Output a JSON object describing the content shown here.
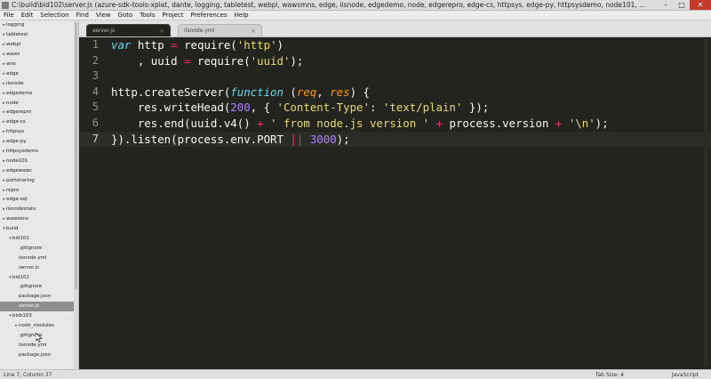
{
  "window": {
    "title": "C:\\build\\bid102\\server.js (azure-sdk-tools-xplat, dante, logging, tabletest, webpi, wawsmns, edge, iisnode, edgedemo, node, edgerepro, edge-cs, httpsys, edge-py, httpsysdemo, node101, ...",
    "buttons": {
      "minimize": "–",
      "maximize": "□",
      "close": "✕"
    }
  },
  "menu": [
    "File",
    "Edit",
    "Selection",
    "Find",
    "View",
    "Goto",
    "Tools",
    "Project",
    "Preferences",
    "Help"
  ],
  "sidebar": {
    "items": [
      {
        "label": "logging",
        "indent": 0,
        "arrow": "▸"
      },
      {
        "label": "tabletest",
        "indent": 0,
        "arrow": "▸"
      },
      {
        "label": "webpi",
        "indent": 0,
        "arrow": "▸"
      },
      {
        "label": "waws",
        "indent": 0,
        "arrow": "▸"
      },
      {
        "label": "wns",
        "indent": 0,
        "arrow": "▸"
      },
      {
        "label": "edge",
        "indent": 0,
        "arrow": "▸"
      },
      {
        "label": "iisnode",
        "indent": 0,
        "arrow": "▸"
      },
      {
        "label": "edgedemo",
        "indent": 0,
        "arrow": "▸"
      },
      {
        "label": "node",
        "indent": 0,
        "arrow": "▸"
      },
      {
        "label": "edgerepro",
        "indent": 0,
        "arrow": "▸"
      },
      {
        "label": "edge-cs",
        "indent": 0,
        "arrow": "▸"
      },
      {
        "label": "httpsys",
        "indent": 0,
        "arrow": "▸"
      },
      {
        "label": "edge-py",
        "indent": 0,
        "arrow": "▸"
      },
      {
        "label": "httpsysdemo",
        "indent": 0,
        "arrow": "▸"
      },
      {
        "label": "node101",
        "indent": 0,
        "arrow": "▸"
      },
      {
        "label": "edgewawc",
        "indent": 0,
        "arrow": "▸"
      },
      {
        "label": "portsharing",
        "indent": 0,
        "arrow": "▸"
      },
      {
        "label": "repro",
        "indent": 0,
        "arrow": "▸"
      },
      {
        "label": "edge-sql",
        "indent": 0,
        "arrow": "▸"
      },
      {
        "label": "iisnodestats",
        "indent": 0,
        "arrow": "▸"
      },
      {
        "label": "wawsenv",
        "indent": 0,
        "arrow": "▸"
      },
      {
        "label": "build",
        "indent": 0,
        "arrow": "▾"
      },
      {
        "label": "bid101",
        "indent": 1,
        "arrow": "▾"
      },
      {
        "label": ".gitignore",
        "indent": 2,
        "arrow": ""
      },
      {
        "label": "iisnode.yml",
        "indent": 2,
        "arrow": ""
      },
      {
        "label": "server.js",
        "indent": 2,
        "arrow": ""
      },
      {
        "label": "bid102",
        "indent": 1,
        "arrow": "▾"
      },
      {
        "label": ".gitignore",
        "indent": 2,
        "arrow": ""
      },
      {
        "label": "package.json",
        "indent": 2,
        "arrow": ""
      },
      {
        "label": "server.js",
        "indent": 2,
        "arrow": "",
        "selected": true
      },
      {
        "label": "bisb103",
        "indent": 1,
        "arrow": "▾"
      },
      {
        "label": "node_modules",
        "indent": 2,
        "arrow": "▸"
      },
      {
        "label": ".gitignore",
        "indent": 2,
        "arrow": ""
      },
      {
        "label": "iisnode.yml",
        "indent": 2,
        "arrow": ""
      },
      {
        "label": "package.json",
        "indent": 2,
        "arrow": ""
      }
    ]
  },
  "tabs": [
    {
      "label": "server.js",
      "close": "×",
      "active": true
    },
    {
      "label": "iisnode.yml",
      "close": "×",
      "active": false
    }
  ],
  "editor": {
    "line_numbers": [
      "1",
      "2",
      "3",
      "4",
      "5",
      "6",
      "7"
    ],
    "current_line": "7",
    "lines": [
      [
        {
          "t": "var",
          "c": "k"
        },
        {
          "t": " http ",
          "c": ""
        },
        {
          "t": "=",
          "c": "o"
        },
        {
          "t": " require(",
          "c": ""
        },
        {
          "t": "'http'",
          "c": "s"
        },
        {
          "t": ")",
          "c": ""
        }
      ],
      [
        {
          "t": "    , uuid ",
          "c": ""
        },
        {
          "t": "=",
          "c": "o"
        },
        {
          "t": " require(",
          "c": ""
        },
        {
          "t": "'uuid'",
          "c": "s"
        },
        {
          "t": ");",
          "c": ""
        }
      ],
      [],
      [
        {
          "t": "http.createServer(",
          "c": ""
        },
        {
          "t": "function",
          "c": "k"
        },
        {
          "t": " (",
          "c": ""
        },
        {
          "t": "req",
          "c": "p"
        },
        {
          "t": ", ",
          "c": ""
        },
        {
          "t": "res",
          "c": "p"
        },
        {
          "t": ") {",
          "c": ""
        }
      ],
      [
        {
          "t": "    res.writeHead(",
          "c": ""
        },
        {
          "t": "200",
          "c": "n"
        },
        {
          "t": ", { ",
          "c": ""
        },
        {
          "t": "'Content-Type'",
          "c": "s"
        },
        {
          "t": ": ",
          "c": ""
        },
        {
          "t": "'text/plain'",
          "c": "s"
        },
        {
          "t": " });",
          "c": ""
        }
      ],
      [
        {
          "t": "    res.end(uuid.v4() ",
          "c": ""
        },
        {
          "t": "+",
          "c": "o"
        },
        {
          "t": " ",
          "c": ""
        },
        {
          "t": "' from node.js version '",
          "c": "s"
        },
        {
          "t": " ",
          "c": ""
        },
        {
          "t": "+",
          "c": "o"
        },
        {
          "t": " process.version ",
          "c": ""
        },
        {
          "t": "+",
          "c": "o"
        },
        {
          "t": " ",
          "c": ""
        },
        {
          "t": "'\\n'",
          "c": "s"
        },
        {
          "t": ");",
          "c": ""
        }
      ],
      [
        {
          "t": "}).listen(process.env.PORT ",
          "c": ""
        },
        {
          "t": "||",
          "c": "o"
        },
        {
          "t": " ",
          "c": ""
        },
        {
          "t": "3000",
          "c": "n"
        },
        {
          "t": ");",
          "c": ""
        }
      ]
    ]
  },
  "statusbar": {
    "position": "Line 7, Column 37",
    "tab_size": "Tab Size: 4",
    "syntax": "JavaScript"
  },
  "colors": {
    "editor_bg": "#23241f",
    "keyword": "#66d9ef",
    "string": "#e6db74",
    "number": "#ae81ff",
    "operator": "#f92672",
    "param": "#fd971f"
  }
}
